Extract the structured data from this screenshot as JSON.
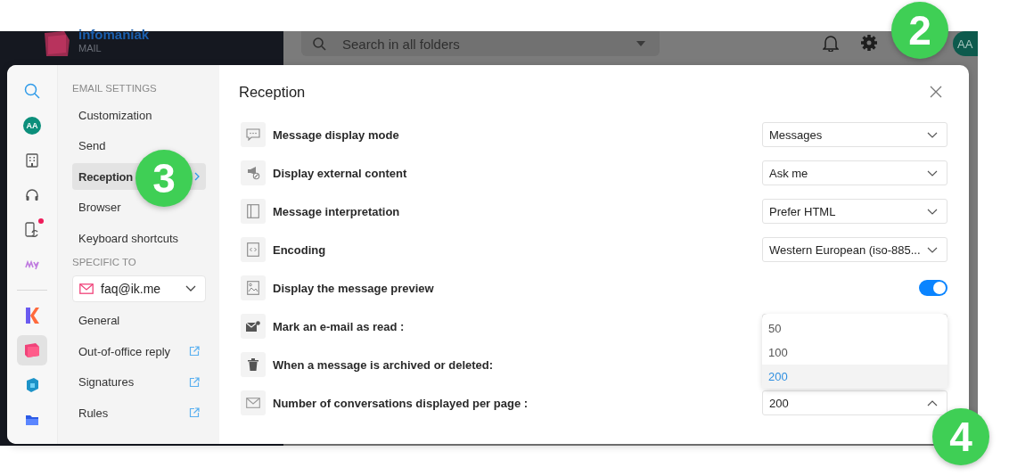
{
  "background_app": {
    "brand": "infomaniak",
    "product": "MAIL",
    "search": {
      "placeholder": "Search in all folders"
    },
    "avatar": "AA"
  },
  "rail": {
    "avatar": "AA",
    "top_items": [
      {
        "kind": "search",
        "selected": false,
        "notification": false
      },
      {
        "kind": "avatar",
        "selected": false,
        "notification": false
      },
      {
        "kind": "building",
        "selected": false,
        "notification": false
      },
      {
        "kind": "headset",
        "selected": false,
        "notification": false
      },
      {
        "kind": "phone",
        "selected": false,
        "notification": true
      },
      {
        "kind": "squiggle",
        "selected": false,
        "notification": false
      }
    ],
    "bottom_items": [
      {
        "kind": "k-logo",
        "selected": false,
        "notification": false
      },
      {
        "kind": "pink-cube",
        "selected": true,
        "notification": false
      },
      {
        "kind": "blue-cube",
        "selected": false,
        "notification": false
      },
      {
        "kind": "folder",
        "selected": false,
        "notification": false
      }
    ]
  },
  "nav": {
    "sections": [
      {
        "heading": "EMAIL SETTINGS",
        "items": [
          {
            "label": "Customization",
            "selected": false,
            "external": false
          },
          {
            "label": "Send",
            "selected": false,
            "external": false
          },
          {
            "label": "Reception",
            "selected": true,
            "external": false
          },
          {
            "label": "Browser",
            "selected": false,
            "external": false
          },
          {
            "label": "Keyboard shortcuts",
            "selected": false,
            "external": false
          }
        ]
      },
      {
        "heading": "SPECIFIC TO",
        "account": "faq@ik.me",
        "items": [
          {
            "label": "General",
            "selected": false,
            "external": false
          },
          {
            "label": "Out-of-office reply",
            "selected": false,
            "external": true
          },
          {
            "label": "Signatures",
            "selected": false,
            "external": true
          },
          {
            "label": "Rules",
            "selected": false,
            "external": true
          }
        ]
      }
    ]
  },
  "panel": {
    "title": "Reception",
    "rows": [
      {
        "label": "Message display mode",
        "kind": "select",
        "value": "Messages",
        "open": false
      },
      {
        "label": "Display external content",
        "kind": "select",
        "value": "Ask me",
        "open": false
      },
      {
        "label": "Message interpretation",
        "kind": "select",
        "value": "Prefer HTML",
        "open": false
      },
      {
        "label": "Encoding",
        "kind": "select",
        "value": "Western European (iso-885...",
        "open": false
      },
      {
        "label": "Display the message preview",
        "kind": "toggle",
        "on": true
      },
      {
        "label": "Mark an e-mail as read :",
        "kind": "covered"
      },
      {
        "label": "When a message is archived or deleted:",
        "kind": "covered"
      },
      {
        "label": "Number of conversations displayed per page :",
        "kind": "select",
        "value": "200",
        "open": true
      }
    ]
  },
  "dropdown": {
    "options": [
      {
        "label": "50",
        "selected": false
      },
      {
        "label": "100",
        "selected": false
      },
      {
        "label": "200",
        "selected": true
      }
    ]
  },
  "callouts": [
    {
      "number": "2"
    },
    {
      "number": "3"
    },
    {
      "number": "4"
    }
  ]
}
